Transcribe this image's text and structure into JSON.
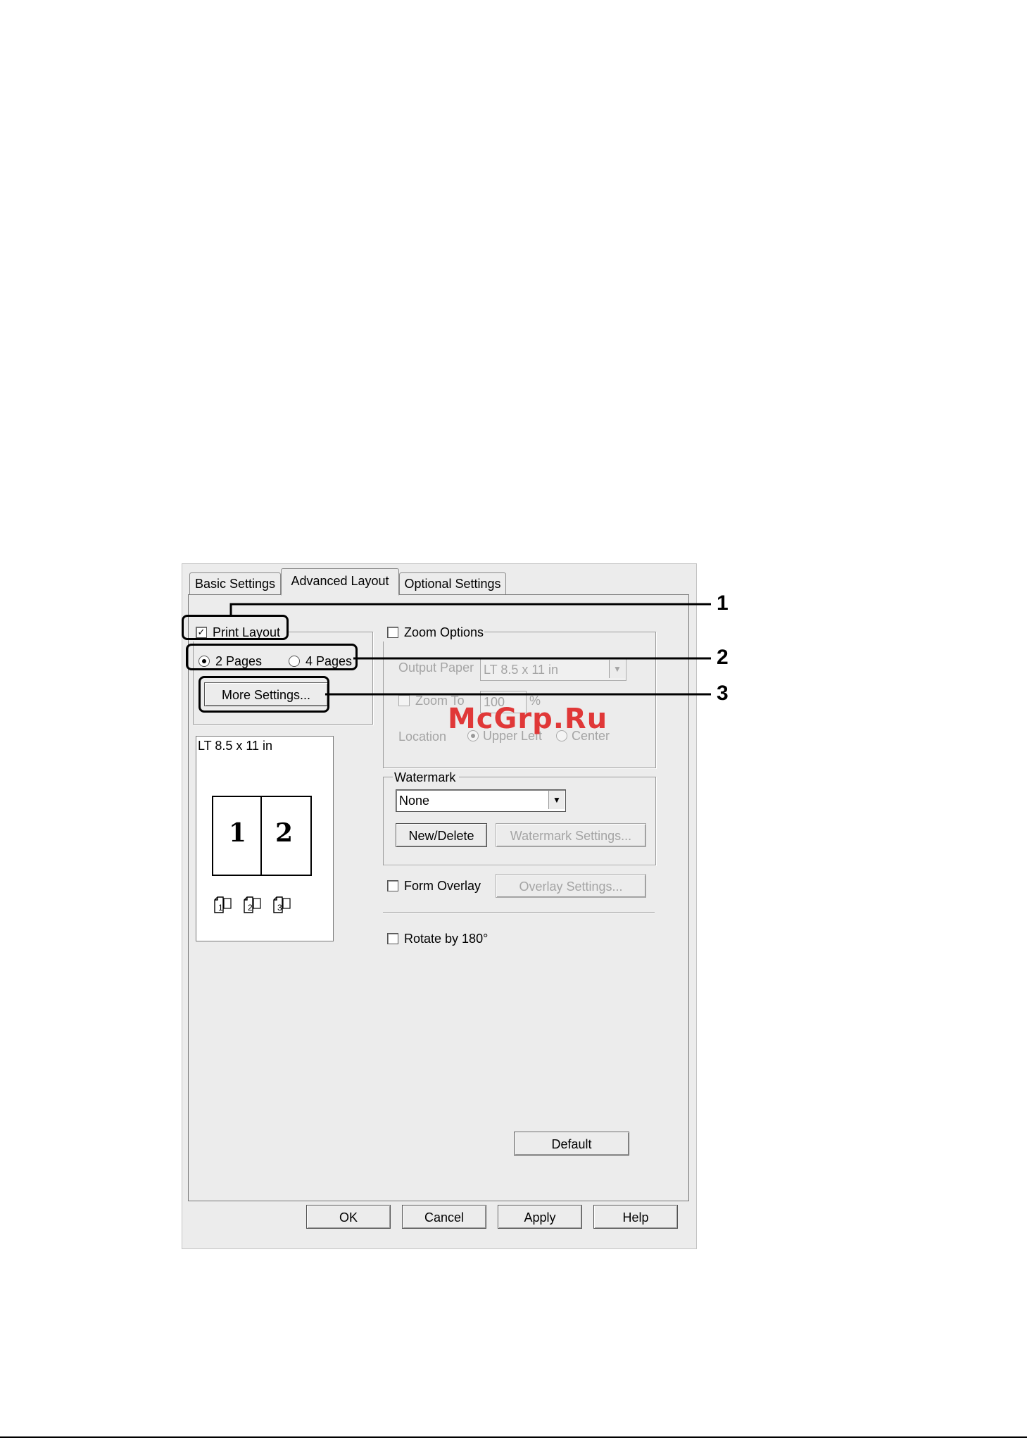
{
  "tabs": [
    {
      "label": "Basic Settings"
    },
    {
      "label": "Advanced Layout"
    },
    {
      "label": "Optional Settings"
    }
  ],
  "print_layout": {
    "label": "Print Layout",
    "checked": true,
    "pages_2": "2 Pages",
    "pages_4": "4 Pages",
    "more_settings": "More Settings...",
    "preview_paper": "LT 8.5 x 11 in",
    "preview_page1": "1",
    "preview_page2": "2",
    "mini_labels": [
      "1",
      "2",
      "3"
    ]
  },
  "zoom": {
    "label": "Zoom Options",
    "output_paper_label": "Output Paper",
    "output_paper_value": "LT 8.5 x 11 in",
    "zoom_to_label": "Zoom To",
    "zoom_value": "100",
    "percent": "%",
    "location_label": "Location",
    "upper_left": "Upper Left",
    "center": "Center"
  },
  "watermark": {
    "group_label": "Watermark",
    "value": "None",
    "new_delete": "New/Delete",
    "settings": "Watermark Settings..."
  },
  "form_overlay": {
    "label": "Form Overlay",
    "settings": "Overlay Settings..."
  },
  "rotate": {
    "label": "Rotate by 180°"
  },
  "default_button": "Default",
  "footer": {
    "ok": "OK",
    "cancel": "Cancel",
    "apply": "Apply",
    "help": "Help"
  },
  "callouts": [
    "1",
    "2",
    "3"
  ],
  "site_watermark": "McGrp.Ru"
}
